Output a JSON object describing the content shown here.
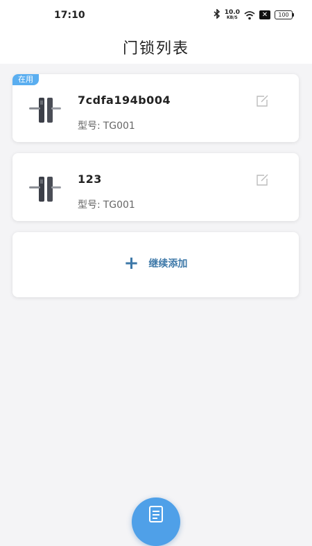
{
  "status_bar": {
    "time": "17:10",
    "net_speed_value": "10.0",
    "net_speed_unit": "KB/S",
    "battery": "100",
    "icons": [
      "bluetooth-icon",
      "wifi-icon",
      "sim-x-icon",
      "battery-icon"
    ]
  },
  "header": {
    "title": "门锁列表"
  },
  "locks": [
    {
      "tag": "在用",
      "name": "7cdfa194b004",
      "model_label": "型号:",
      "model_value": "TG001"
    },
    {
      "name": "123",
      "model_label": "型号:",
      "model_value": "TG001"
    }
  ],
  "add": {
    "icon": "plus-icon",
    "label": "继续添加"
  },
  "colors": {
    "accent": "#3d78a8",
    "tag_bg": "#5aaef0",
    "fab_bg": "#4fa0e8",
    "page_bg": "#f4f4f6"
  }
}
